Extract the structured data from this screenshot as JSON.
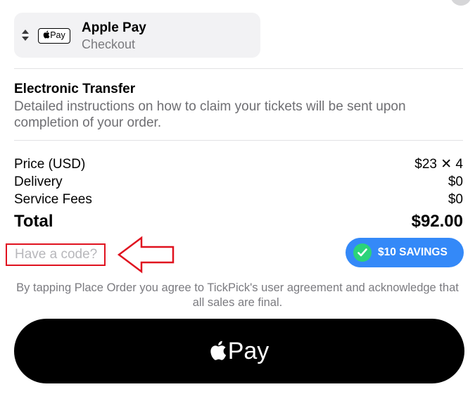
{
  "payment_method": {
    "mark_label": "Pay",
    "title": "Apple Pay",
    "subtitle": "Checkout"
  },
  "delivery": {
    "title": "Electronic Transfer",
    "description": "Detailed instructions on how to claim your tickets will be sent upon completion of your order."
  },
  "price_breakdown": [
    {
      "label": "Price (USD)",
      "value": "$23 ✕ 4"
    },
    {
      "label": "Delivery",
      "value": "$0"
    },
    {
      "label": "Service Fees",
      "value": "$0"
    }
  ],
  "total": {
    "label": "Total",
    "value": "$92.00"
  },
  "promo": {
    "link_text": "Have a code?"
  },
  "savings_badge": {
    "text": "$10 SAVINGS"
  },
  "agreement_text": "By tapping Place Order you agree to TickPick's user agreement and acknowledge that all sales are final.",
  "pay_button": {
    "label": "Pay"
  },
  "colors": {
    "savings_blue": "#3489f8",
    "check_green": "#2bd37a",
    "annotation_red": "#e0121f",
    "button_black": "#000000"
  },
  "icons": [
    "sort-icon",
    "apple-logo-icon",
    "checkmark-icon",
    "arrow-annotation-icon"
  ]
}
